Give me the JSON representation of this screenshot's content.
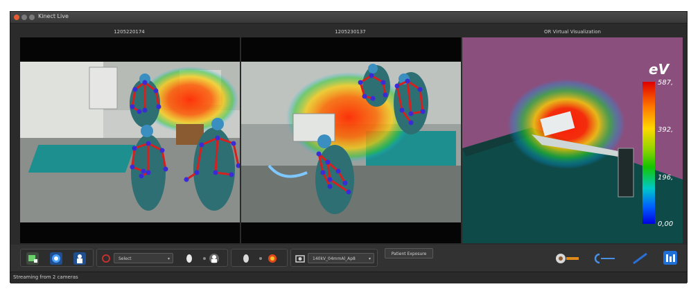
{
  "window": {
    "title": "Kinect Live"
  },
  "panes": [
    {
      "header": "1205220174"
    },
    {
      "header": "1205230137"
    },
    {
      "header": "OR Virtual Visualization"
    }
  ],
  "colorbar": {
    "unit": "eV",
    "ticks": [
      "587,",
      "392,",
      "196,",
      "0,00"
    ]
  },
  "toolbar": {
    "select_value": "Select",
    "preset_value": "140kV_04mmAl_Ap8",
    "patient_exposure_label": "Patient Exposure"
  },
  "status": {
    "text": "Streaming from 2 cameras"
  },
  "colors": {
    "heat_hot": "#e00000",
    "skeleton_bone": "#d62020",
    "skeleton_joint": "#3a2bd6",
    "floor_teal": "#0e4a48",
    "wall_purple": "#8a4f7d"
  }
}
